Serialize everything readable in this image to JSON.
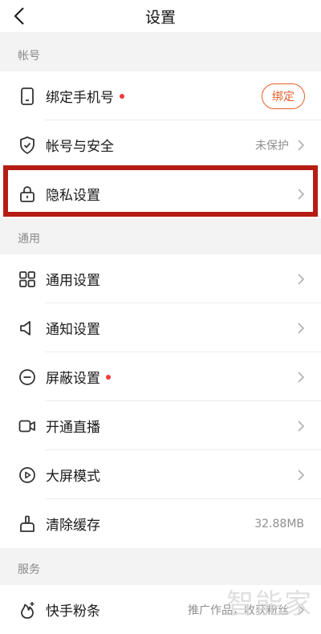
{
  "header": {
    "title": "设置"
  },
  "sections": {
    "account": {
      "label": "帐号",
      "items": [
        {
          "label": "绑定手机号",
          "action": "绑定"
        },
        {
          "label": "帐号与安全",
          "value": "未保护"
        },
        {
          "label": "隐私设置"
        }
      ]
    },
    "general": {
      "label": "通用",
      "items": [
        {
          "label": "通用设置"
        },
        {
          "label": "通知设置"
        },
        {
          "label": "屏蔽设置"
        },
        {
          "label": "开通直播"
        },
        {
          "label": "大屏模式"
        },
        {
          "label": "清除缓存",
          "value": "32.88MB"
        }
      ]
    },
    "service": {
      "label": "服务",
      "items": [
        {
          "label": "快手粉条",
          "value": "推广作品，收获粉丝"
        }
      ]
    }
  },
  "watermark": "智能家",
  "colors": {
    "accent": "#e85d2a",
    "badge": "#ef3a3a",
    "highlight": "#b51d14"
  }
}
